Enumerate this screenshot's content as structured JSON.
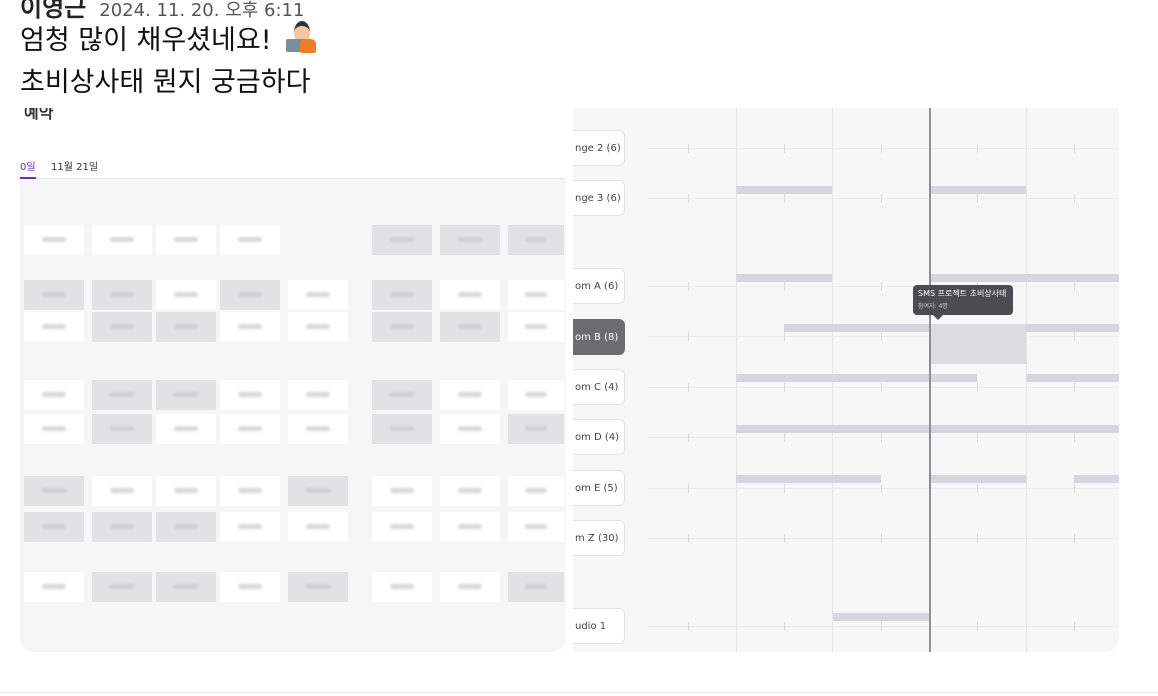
{
  "header": {
    "author": "이영근",
    "date": "2024. 11. 20. 오후 6:11"
  },
  "messages": [
    {
      "text": "엄청 많이 채우셨네요!",
      "emoji": "technologist-emoji"
    },
    {
      "text": "초비상사태 뭔지 궁금하다"
    }
  ],
  "left_panel": {
    "title": "예약",
    "tabs": [
      {
        "label": "0일",
        "active": true
      },
      {
        "label": "11월 21일",
        "active": false
      }
    ]
  },
  "right_panel": {
    "rooms": [
      {
        "label": "nge 2 (6)",
        "active": false
      },
      {
        "label": "nge 3 (6)",
        "active": false
      },
      {
        "label": "om A (6)",
        "active": false
      },
      {
        "label": "om B (8)",
        "active": true
      },
      {
        "label": "om C (4)",
        "active": false
      },
      {
        "label": "om D (4)",
        "active": false
      },
      {
        "label": "om E (5)",
        "active": false
      },
      {
        "label": "m Z (30)",
        "active": false
      },
      {
        "label": "udio 1",
        "active": false
      }
    ],
    "tooltip": {
      "title": "SMS 프로젝트 초비상사태",
      "subtitle": "참여자: 4명"
    }
  },
  "colors": {
    "accent": "#6a2bbf",
    "selected_room": "#6b6b70",
    "booking_bar": "#d6d6dc",
    "selected_bar": "#58585e",
    "now_line": "#8e8e93"
  }
}
